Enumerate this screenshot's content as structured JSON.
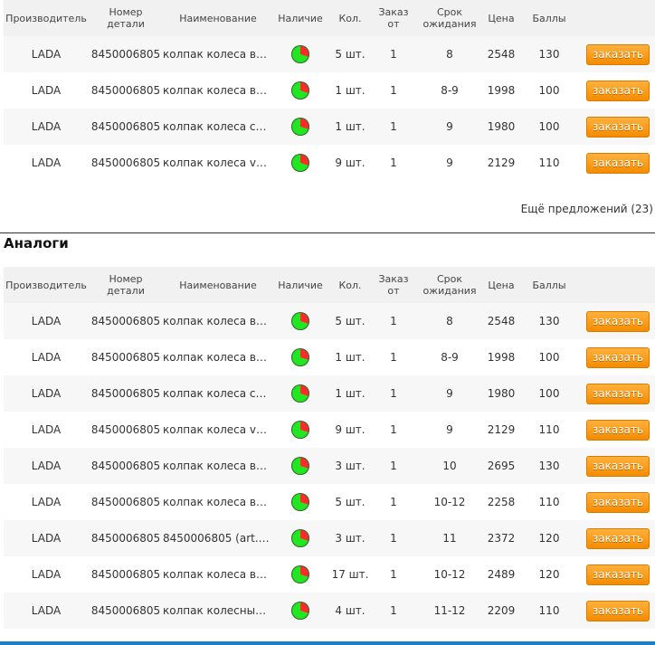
{
  "headers": {
    "manufacturer": "Производитель",
    "part_number": "Номер детали",
    "name": "Наименование",
    "availability": "Наличие",
    "quantity": "Кол.",
    "min_order": "Заказ от",
    "wait_time": "Срок ожидания",
    "price": "Цена",
    "points": "Баллы"
  },
  "order_button_label": "заказать",
  "more_offers": "Ещё предложений (23)",
  "analogs_title": "Аналоги",
  "colors": {
    "accent": "#f58c00",
    "availability_in": "#23e623",
    "availability_out": "#ff2a2a"
  },
  "main_offers": [
    {
      "manufacturer": "LADA",
      "part_number": "8450006805",
      "name": "колпак колеса в с...",
      "quantity": "5 шт.",
      "min_order": "1",
      "wait": "8",
      "price": "2548",
      "points": "130"
    },
    {
      "manufacturer": "LADA",
      "part_number": "8450006805",
      "name": "колпак колеса в с...",
      "quantity": "1 шт.",
      "min_order": "1",
      "wait": "8-9",
      "price": "1998",
      "points": "100"
    },
    {
      "manufacturer": "LADA",
      "part_number": "8450006805",
      "name": "колпак колеса сб ...",
      "quantity": "1 шт.",
      "min_order": "1",
      "wait": "9",
      "price": "1980",
      "points": "100"
    },
    {
      "manufacturer": "LADA",
      "part_number": "8450006805",
      "name": "колпак колеса ves...",
      "quantity": "9 шт.",
      "min_order": "1",
      "wait": "9",
      "price": "2129",
      "points": "110"
    }
  ],
  "analog_offers": [
    {
      "manufacturer": "LADA",
      "part_number": "8450006805",
      "name": "колпак колеса в с...",
      "quantity": "5 шт.",
      "min_order": "1",
      "wait": "8",
      "price": "2548",
      "points": "130"
    },
    {
      "manufacturer": "LADA",
      "part_number": "8450006805",
      "name": "колпак колеса в с...",
      "quantity": "1 шт.",
      "min_order": "1",
      "wait": "8-9",
      "price": "1998",
      "points": "100"
    },
    {
      "manufacturer": "LADA",
      "part_number": "8450006805",
      "name": "колпак колеса сб ...",
      "quantity": "1 шт.",
      "min_order": "1",
      "wait": "9",
      "price": "1980",
      "points": "100"
    },
    {
      "manufacturer": "LADA",
      "part_number": "8450006805",
      "name": "колпак колеса ves...",
      "quantity": "9 шт.",
      "min_order": "1",
      "wait": "9",
      "price": "2129",
      "points": "110"
    },
    {
      "manufacturer": "LADA",
      "part_number": "8450006805",
      "name": "колпак колеса в с...",
      "quantity": "3 шт.",
      "min_order": "1",
      "wait": "10",
      "price": "2695",
      "points": "130"
    },
    {
      "manufacturer": "LADA",
      "part_number": "8450006805",
      "name": "колпак колеса в с...",
      "quantity": "5 шт.",
      "min_order": "1",
      "wait": "10-12",
      "price": "2258",
      "points": "110"
    },
    {
      "manufacturer": "LADA",
      "part_number": "8450006805",
      "name": "8450006805 (art.8...",
      "quantity": "3 шт.",
      "min_order": "1",
      "wait": "11",
      "price": "2372",
      "points": "120"
    },
    {
      "manufacturer": "LADA",
      "part_number": "8450006805",
      "name": "колпак колеса в с...",
      "quantity": "17 шт.",
      "min_order": "1",
      "wait": "10-12",
      "price": "2489",
      "points": "120"
    },
    {
      "manufacturer": "LADA",
      "part_number": "8450006805",
      "name": "колпак колесный г...",
      "quantity": "4 шт.",
      "min_order": "1",
      "wait": "11-12",
      "price": "2209",
      "points": "110"
    }
  ]
}
